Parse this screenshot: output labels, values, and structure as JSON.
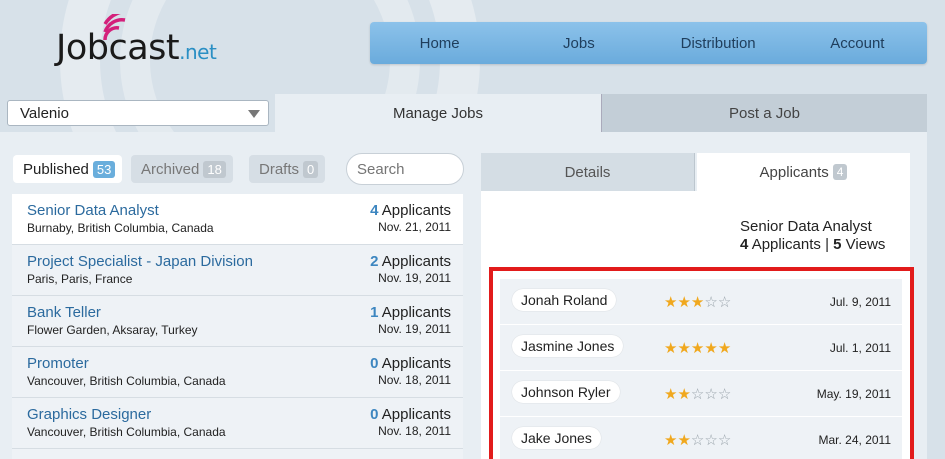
{
  "logo": {
    "brand": "Jobcast",
    "tld": ".net"
  },
  "nav": [
    "Home",
    "Jobs",
    "Distribution",
    "Account"
  ],
  "company_select": {
    "value": "Valenio"
  },
  "main_tabs": {
    "manage": "Manage Jobs",
    "post": "Post a Job"
  },
  "filters": {
    "published": {
      "label": "Published",
      "count": "53"
    },
    "archived": {
      "label": "Archived",
      "count": "18"
    },
    "drafts": {
      "label": "Drafts",
      "count": "0"
    }
  },
  "search": {
    "placeholder": "Search"
  },
  "jobs": [
    {
      "title": "Senior Data Analyst",
      "location": "Burnaby, British Columbia, Canada",
      "count": "4",
      "count_label": "Applicants",
      "date": "Nov. 21, 2011"
    },
    {
      "title": "Project Specialist - Japan Division",
      "location": "Paris, Paris, France",
      "count": "2",
      "count_label": "Applicants",
      "date": "Nov. 19, 2011"
    },
    {
      "title": "Bank Teller",
      "location": "Flower Garden, Aksaray, Turkey",
      "count": "1",
      "count_label": "Applicants",
      "date": "Nov. 19, 2011"
    },
    {
      "title": "Promoter",
      "location": "Vancouver, British Columbia, Canada",
      "count": "0",
      "count_label": "Applicants",
      "date": "Nov. 18, 2011"
    },
    {
      "title": "Graphics Designer",
      "location": "Vancouver, British Columbia, Canada",
      "count": "0",
      "count_label": "Applicants",
      "date": "Nov. 18, 2011"
    }
  ],
  "detail_tabs": {
    "details": "Details",
    "applicants": "Applicants",
    "applicants_count": "4"
  },
  "summary": {
    "title": "Senior Data Analyst",
    "applicants": "4",
    "applicants_label": "Applicants",
    "separator": "|",
    "views": "5",
    "views_label": "Views"
  },
  "applicants": [
    {
      "name": "Jonah Roland",
      "rating": 3,
      "date": "Jul. 9, 2011"
    },
    {
      "name": "Jasmine Jones",
      "rating": 5,
      "date": "Jul. 1, 2011"
    },
    {
      "name": "Johnson Ryler",
      "rating": 2,
      "date": "May. 19, 2011"
    },
    {
      "name": "Jake Jones",
      "rating": 2,
      "date": "Mar. 24, 2011"
    }
  ],
  "colors": {
    "accent": "#6aabdc",
    "highlight": "#e21b1b",
    "star": "#f0a81e"
  }
}
